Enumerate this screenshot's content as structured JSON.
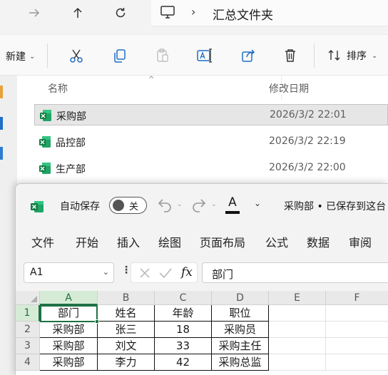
{
  "explorer": {
    "address_path": "汇总文件夹",
    "command_bar": {
      "new_label": "新建",
      "sort_label": "排序"
    },
    "columns": {
      "name": "名称",
      "modified": "修改日期"
    },
    "files": [
      {
        "name": "采购部",
        "modified": "2026/3/2 22:01",
        "selected": true
      },
      {
        "name": "品控部",
        "modified": "2026/3/2 22:19",
        "selected": false
      },
      {
        "name": "生产部",
        "modified": "2026/3/2 22:00",
        "selected": false
      }
    ]
  },
  "excel": {
    "autosave_label": "自动保存",
    "autosave_state": "关",
    "doc_status": "采购部 • 已保存到这台",
    "menu": [
      "文件",
      "开始",
      "插入",
      "绘图",
      "页面布局",
      "公式",
      "数据",
      "审阅"
    ],
    "name_box": "A1",
    "formula_value": "部门",
    "fx_label": "fx",
    "columns": [
      "A",
      "B",
      "C",
      "D",
      "E",
      "F"
    ],
    "rows": [
      "1",
      "2",
      "3",
      "4"
    ],
    "cells": [
      [
        "部门",
        "姓名",
        "年龄",
        "职位"
      ],
      [
        "采购部",
        "张三",
        "18",
        "采购员"
      ],
      [
        "采购部",
        "刘文",
        "33",
        "采购主任"
      ],
      [
        "采购部",
        "李力",
        "42",
        "采购总监"
      ]
    ],
    "accent": "#1e7145"
  }
}
